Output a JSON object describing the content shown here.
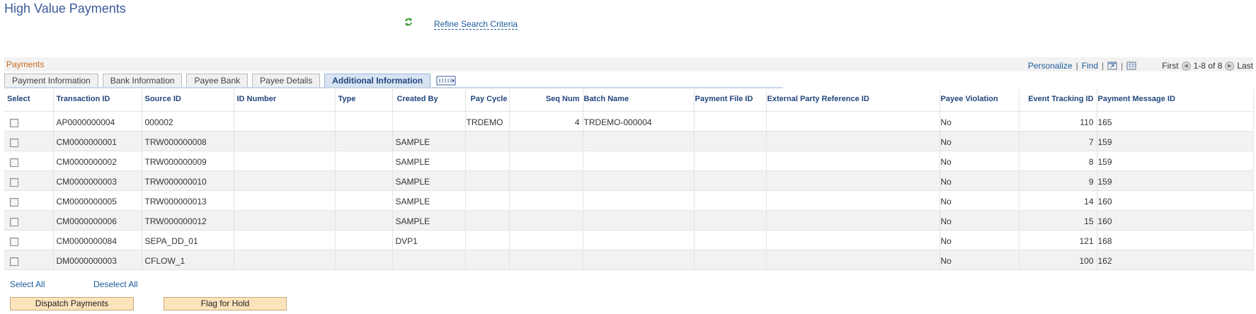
{
  "page": {
    "title": "High Value Payments"
  },
  "header": {
    "refine_link": "Refine Search Criteria"
  },
  "grid": {
    "title": "Payments",
    "nav": {
      "personalize": "Personalize",
      "find": "Find",
      "first": "First",
      "range": "1-8 of 8",
      "last": "Last"
    },
    "tabs": [
      "Payment Information",
      "Bank Information",
      "Payee Bank",
      "Payee Details",
      "Additional Information"
    ],
    "active_tab": "Additional Information",
    "columns": [
      "Select",
      "Transaction ID",
      "Source ID",
      "ID Number",
      "Type",
      "Created By",
      "Pay Cycle",
      "Seq Num",
      "Batch Name",
      "Payment File ID",
      "External Party Reference ID",
      "Payee Violation",
      "Event Tracking ID",
      "Payment Message ID"
    ],
    "rows": [
      {
        "transaction_id": "AP0000000004",
        "source_id": "000002",
        "id_number": "",
        "type": "",
        "created_by": "",
        "pay_cycle": "TRDEMO",
        "seq_num": "4",
        "batch_name": "TRDEMO-000004",
        "payment_file_id": "",
        "ext_ref_id": "",
        "payee_violation": "No",
        "event_tracking_id": "110",
        "payment_message_id": "165"
      },
      {
        "transaction_id": "CM0000000001",
        "source_id": "TRW000000008",
        "id_number": "",
        "type": "",
        "created_by": "SAMPLE",
        "pay_cycle": "",
        "seq_num": "",
        "batch_name": "",
        "payment_file_id": "",
        "ext_ref_id": "",
        "payee_violation": "No",
        "event_tracking_id": "7",
        "payment_message_id": "159"
      },
      {
        "transaction_id": "CM0000000002",
        "source_id": "TRW000000009",
        "id_number": "",
        "type": "",
        "created_by": "SAMPLE",
        "pay_cycle": "",
        "seq_num": "",
        "batch_name": "",
        "payment_file_id": "",
        "ext_ref_id": "",
        "payee_violation": "No",
        "event_tracking_id": "8",
        "payment_message_id": "159"
      },
      {
        "transaction_id": "CM0000000003",
        "source_id": "TRW000000010",
        "id_number": "",
        "type": "",
        "created_by": "SAMPLE",
        "pay_cycle": "",
        "seq_num": "",
        "batch_name": "",
        "payment_file_id": "",
        "ext_ref_id": "",
        "payee_violation": "No",
        "event_tracking_id": "9",
        "payment_message_id": "159"
      },
      {
        "transaction_id": "CM0000000005",
        "source_id": "TRW000000013",
        "id_number": "",
        "type": "",
        "created_by": "SAMPLE",
        "pay_cycle": "",
        "seq_num": "",
        "batch_name": "",
        "payment_file_id": "",
        "ext_ref_id": "",
        "payee_violation": "No",
        "event_tracking_id": "14",
        "payment_message_id": "160"
      },
      {
        "transaction_id": "CM0000000006",
        "source_id": "TRW000000012",
        "id_number": "",
        "type": "",
        "created_by": "SAMPLE",
        "pay_cycle": "",
        "seq_num": "",
        "batch_name": "",
        "payment_file_id": "",
        "ext_ref_id": "",
        "payee_violation": "No",
        "event_tracking_id": "15",
        "payment_message_id": "160"
      },
      {
        "transaction_id": "CM0000000084",
        "source_id": "SEPA_DD_01",
        "id_number": "",
        "type": "",
        "created_by": "DVP1",
        "pay_cycle": "",
        "seq_num": "",
        "batch_name": "",
        "payment_file_id": "",
        "ext_ref_id": "",
        "payee_violation": "No",
        "event_tracking_id": "121",
        "payment_message_id": "168"
      },
      {
        "transaction_id": "DM0000000003",
        "source_id": "CFLOW_1",
        "id_number": "",
        "type": "",
        "created_by": "",
        "pay_cycle": "",
        "seq_num": "",
        "batch_name": "",
        "payment_file_id": "",
        "ext_ref_id": "",
        "payee_violation": "No",
        "event_tracking_id": "100",
        "payment_message_id": "162"
      }
    ]
  },
  "actions": {
    "select_all": "Select All",
    "deselect_all": "Deselect All",
    "dispatch": "Dispatch Payments",
    "flag_hold": "Flag for Hold"
  },
  "colors": {
    "title": "#3c5a9a",
    "grid_title": "#c9691a",
    "header_text": "#23467e",
    "link": "#1a5a9a",
    "button_bg": "#fbe3bc",
    "active_tab_bg": "#d8e4f2"
  },
  "icons": {
    "refresh": "refresh-icon",
    "zoom": "zoom-grid-icon",
    "download": "download-icon",
    "first": "first-arrow-icon",
    "last": "last-arrow-icon",
    "expand_tabs": "show-all-columns-icon"
  }
}
